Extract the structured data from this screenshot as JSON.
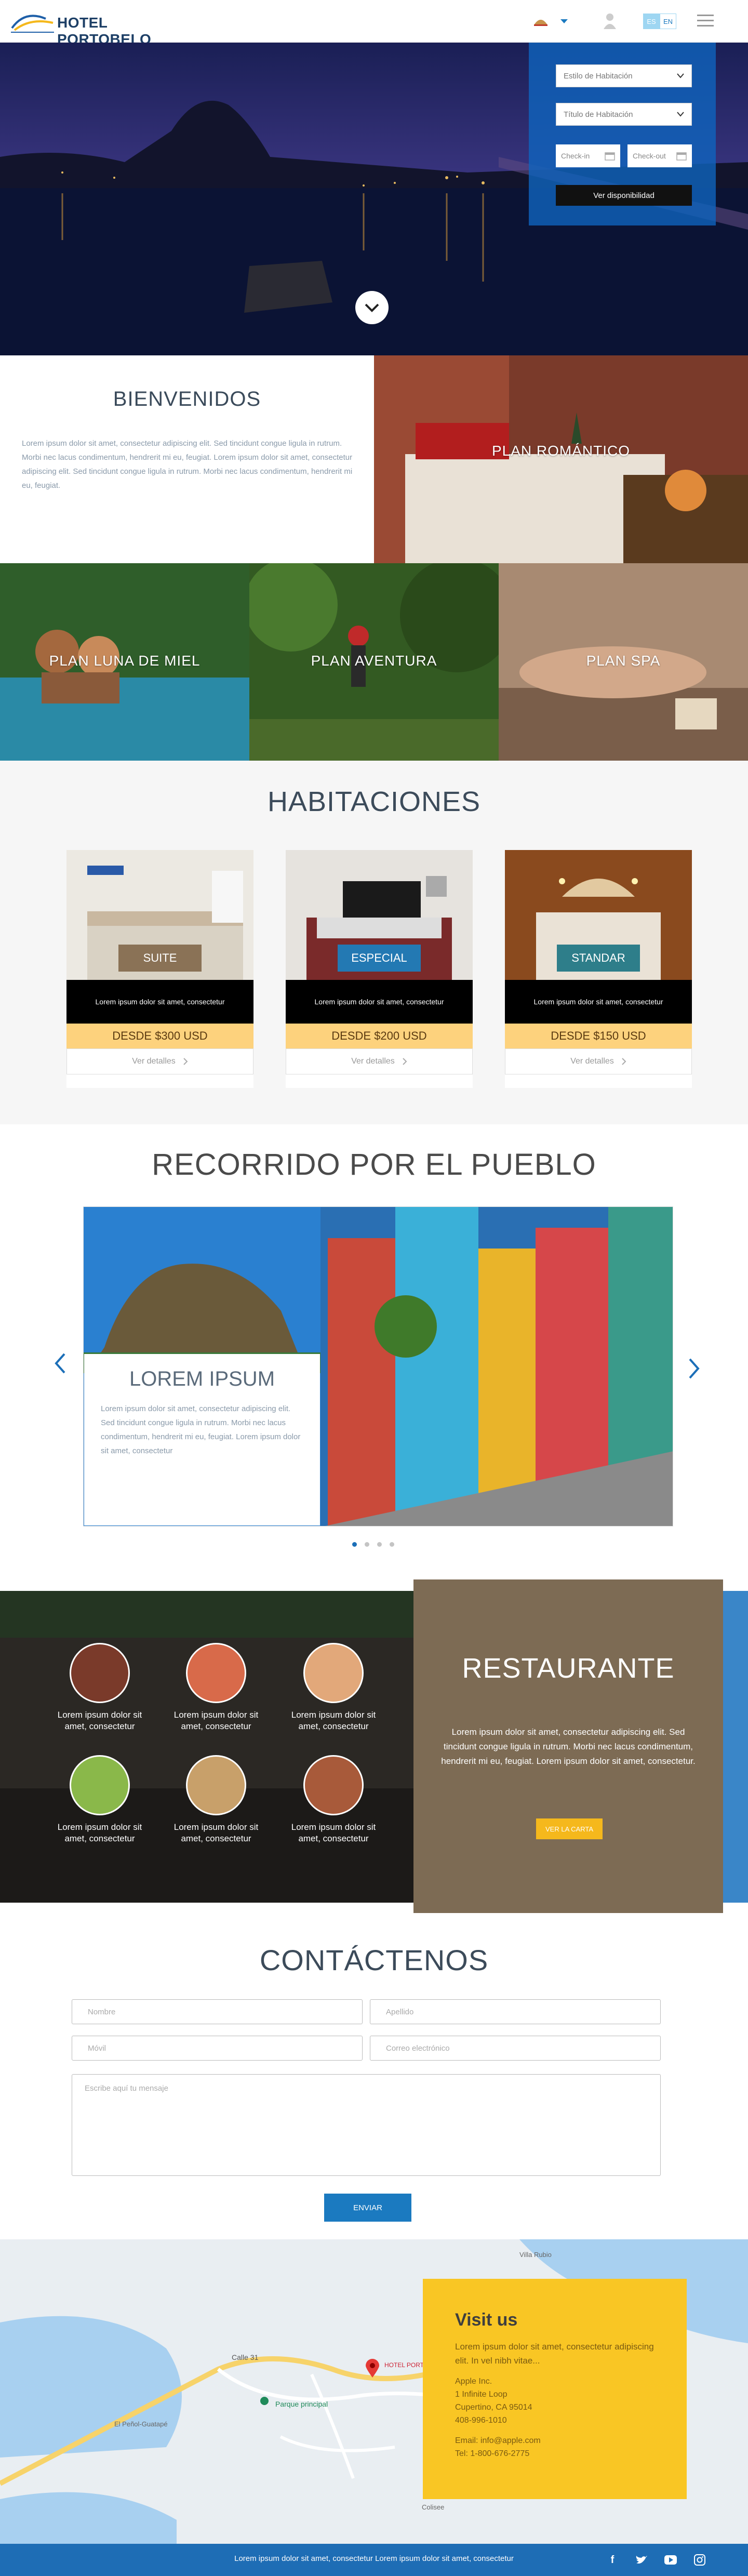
{
  "header": {
    "brand": "HOTEL PORTOBELO",
    "lang_active": "ES",
    "lang_other": "EN"
  },
  "booking": {
    "room_style_placeholder": "Estilo de Habitación",
    "room_title_placeholder": "Título de Habitación",
    "checkin": "Check-in",
    "checkout": "Check-out",
    "submit": "Ver disponibilidad"
  },
  "welcome": {
    "title": "BIENVENIDOS",
    "text": "Lorem ipsum dolor sit amet, consectetur adipiscing elit. Sed tincidunt congue ligula in rutrum. Morbi nec lacus condimentum, hendrerit mi eu, feugiat. Lorem ipsum dolor sit amet, consectetur adipiscing elit. Sed tincidunt congue ligula in rutrum. Morbi nec lacus condimentum, hendrerit mi eu, feugiat."
  },
  "plans": [
    "PLAN ROMÁNTICO",
    "PLAN LUNA DE MIEL",
    "PLAN AVENTURA",
    "PLAN SPA"
  ],
  "rooms": {
    "title": "HABITACIONES",
    "items": [
      {
        "badge": "SUITE",
        "desc": "Lorem ipsum dolor sit amet, consectetur",
        "price": "DESDE $300 USD",
        "details": "Ver detalles"
      },
      {
        "badge": "ESPECIAL",
        "desc": "Lorem ipsum dolor sit amet, consectetur",
        "price": "DESDE $200 USD",
        "details": "Ver detalles"
      },
      {
        "badge": "STANDAR",
        "desc": "Lorem ipsum dolor sit amet, consectetur",
        "price": "DESDE $150 USD",
        "details": "Ver detalles"
      }
    ]
  },
  "tour": {
    "title": "RECORRIDO POR EL PUEBLO",
    "card_title": "LOREM IPSUM",
    "card_text": "Lorem ipsum dolor sit amet, consectetur adipiscing elit. Sed tincidunt congue ligula in rutrum. Morbi nec lacus condimentum, hendrerit mi eu, feugiat. Lorem ipsum dolor sit amet, consectetur"
  },
  "restaurant": {
    "dish_caption": "Lorem ipsum dolor sit amet, consectetur",
    "title": "RESTAURANTE",
    "text": "Lorem ipsum dolor sit amet, consectetur adipiscing elit. Sed tincidunt congue ligula in rutrum. Morbi nec lacus condimentum, hendrerit mi eu, feugiat. Lorem ipsum dolor sit amet, consectetur.",
    "button": "VER LA CARTA"
  },
  "contact": {
    "title": "CONTÁCTENOS",
    "name": "Nombre",
    "surname": "Apellido",
    "mobile": "Móvil",
    "email": "Correo electrónico",
    "message": "Escribe aquí tu mensaje",
    "send": "ENVIAR"
  },
  "map": {
    "labels": {
      "calle": "Calle 31",
      "park": "Parque principal",
      "hotel": "HOTEL PORTOBELO GUATAPÉ",
      "road": "El Peñol-Guatapé",
      "colisee": "Colisee",
      "villa": "Villa Rubio"
    }
  },
  "visit": {
    "title": "Visit us",
    "intro": "Lorem ipsum dolor sit amet, consectetur adipiscing elit. In vel nibh vitae...",
    "company": "Apple Inc.",
    "street": "1 Infinite Loop",
    "city": "Cupertino, CA 95014",
    "phone1": "408-996-1010",
    "email": "Email: info@apple.com",
    "phone2": "Tel: 1-800-676-2775"
  },
  "footer": {
    "text": "Lorem ipsum dolor sit amet, consectetur Lorem ipsum dolor sit amet, consectetur"
  },
  "colors": {
    "primary_blue": "#1b7ac0",
    "price_yellow": "#fdd27d",
    "visit_yellow": "#f9c624",
    "restaurant_brown": "#7d6b54"
  },
  "icons": [
    "logo-mark-icon",
    "colombia-flag-icon",
    "chevron-down-icon",
    "user-icon",
    "menu-icon",
    "calendar-icon",
    "chevron-right-icon",
    "chevron-left-icon",
    "map-pin-icon",
    "facebook-icon",
    "twitter-icon",
    "youtube-icon",
    "instagram-icon"
  ]
}
